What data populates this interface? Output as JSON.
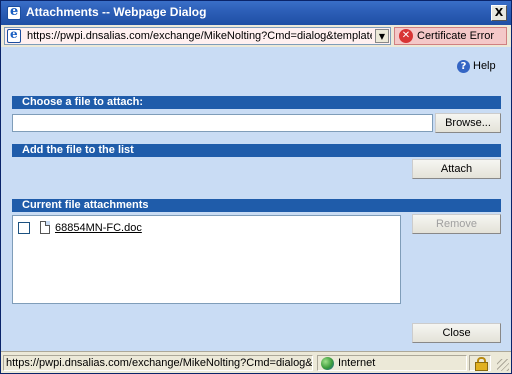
{
  "window": {
    "title": "Attachments -- Webpage Dialog",
    "close_glyph": "X"
  },
  "address": {
    "url": "https://pwpi.dnsalias.com/exchange/MikeNolting?Cmd=dialog&template=",
    "certificate_error": "Certificate Error"
  },
  "help": {
    "label": "Help",
    "icon_glyph": "?"
  },
  "sections": {
    "choose_file": "Choose a file to attach:",
    "add_file": "Add the file to the list",
    "current": "Current file attachments"
  },
  "file_input": {
    "value": ""
  },
  "buttons": {
    "browse": "Browse...",
    "attach": "Attach",
    "remove": "Remove",
    "close": "Close"
  },
  "attachments": [
    {
      "name": "68854MN-FC.doc",
      "checked": false
    }
  ],
  "status": {
    "url": "https://pwpi.dnsalias.com/exchange/MikeNolting?Cmd=dialog&te",
    "zone": "Internet"
  },
  "colors": {
    "section_bar": "#1f5caa",
    "content_bg": "#c9dcf4",
    "title_bar": "#2d5fb8"
  }
}
